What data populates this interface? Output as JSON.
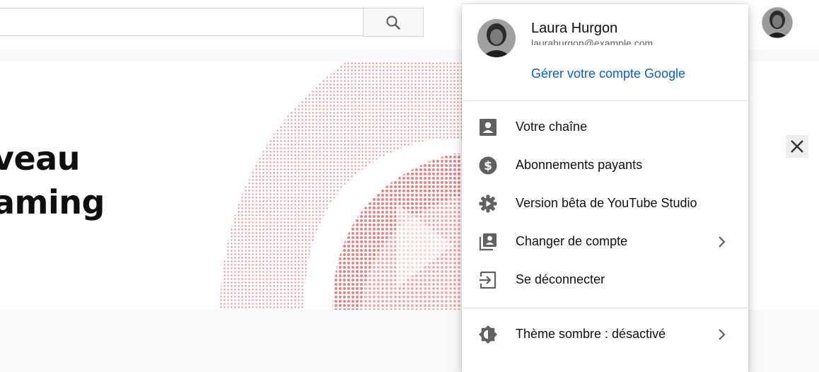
{
  "masthead": {
    "search": {
      "value": "",
      "placeholder": ""
    },
    "search_button_icon": "search-icon",
    "avatar_icon": "account-avatar"
  },
  "banner": {
    "headline_line1": "veau",
    "headline_line2": "aming",
    "close_icon": "close-icon",
    "accent_color": "#ef8080"
  },
  "account_menu": {
    "user": {
      "name": "Laura Hurgon",
      "email": "laurahurgon@example.com",
      "manage_link": "Gérer votre compte Google"
    },
    "items": [
      {
        "label": "Votre chaîne",
        "icon": "person-box-icon",
        "has_submenu": false
      },
      {
        "label": "Abonnements payants",
        "icon": "dollar-circle-icon",
        "has_submenu": false
      },
      {
        "label": "Version bêta de YouTube Studio",
        "icon": "gear-icon",
        "has_submenu": false
      },
      {
        "label": "Changer de compte",
        "icon": "switch-account-icon",
        "has_submenu": true
      },
      {
        "label": "Se déconnecter",
        "icon": "sign-out-icon",
        "has_submenu": false
      }
    ],
    "theme_item": {
      "label": "Thème sombre : désactivé",
      "icon": "dark-theme-icon",
      "has_submenu": true
    }
  },
  "colors": {
    "link_blue": "#065fd4",
    "icon_gray": "#606060",
    "text": "#0f0f0f"
  }
}
